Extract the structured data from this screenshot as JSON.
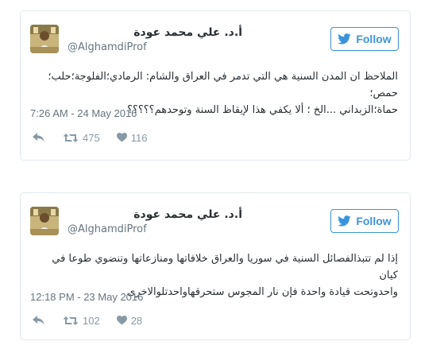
{
  "tweets": [
    {
      "display_name": "أ.د. علي محمد عودة",
      "screen_name": "@AlghamdiProf",
      "follow_label": "Follow",
      "text_lines": [
        "الملاحظ ان المدن السنية هي التي تدمر في العراق والشام: الرمادي؛الفلوجة؛حلب؛حمص؛",
        "حماة؛الزبداني ...الخ ؛ ألا يكفي هذا لإيقاظ السنة وتوحدهم؟؟؟؟؟"
      ],
      "timestamp": "7:26 AM - 24 May 2016",
      "retweets": "475",
      "likes": "116"
    },
    {
      "display_name": "أ.د. علي محمد عودة",
      "screen_name": "@AlghamdiProf",
      "follow_label": "Follow",
      "text_lines": [
        "إذا لم تتبذالفصائل السنية في سوريا والعراق خلافاتها ومنازعاتها وتنضوي طوعا في كيان",
        "واحدوتحت قيادة واحدة فإن نار المجوس ستحرقهاواحدتلوالاخرى"
      ],
      "timestamp": "12:18 PM - 23 May 2016",
      "retweets": "102",
      "likes": "28"
    }
  ],
  "icons": {
    "follow": "twitter-bird-icon",
    "reply": "reply-icon",
    "retweet": "retweet-icon",
    "like": "heart-icon"
  },
  "colors": {
    "brand": "#3b94d9",
    "border": "#e1e8ed",
    "text": "#292f33",
    "muted": "#66757f",
    "action": "#8899a6"
  }
}
